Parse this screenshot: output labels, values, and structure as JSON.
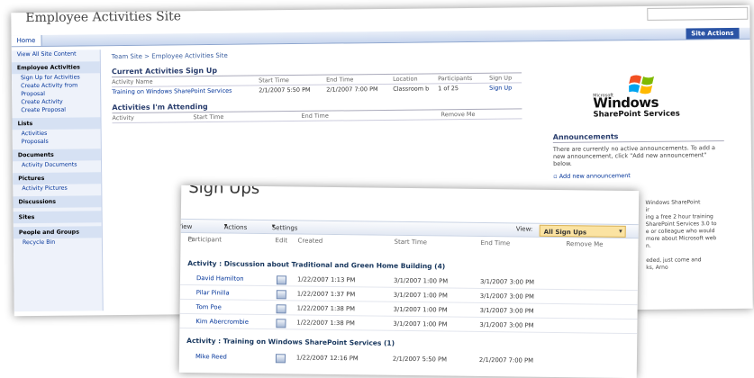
{
  "back": {
    "site_title": "Employee Activities Site",
    "nav_home": "Home",
    "site_actions": "Site Actions",
    "quicklaunch": [
      {
        "text": "View All Site Content",
        "kind": "item"
      },
      {
        "text": "Employee Activities",
        "kind": "head"
      },
      {
        "text": "Sign Up for Activities",
        "kind": "item"
      },
      {
        "text": "Create Activity from Proposal",
        "kind": "item"
      },
      {
        "text": "Create Activity",
        "kind": "item"
      },
      {
        "text": "Create Proposal",
        "kind": "item"
      },
      {
        "text": "Lists",
        "kind": "head"
      },
      {
        "text": "Activities",
        "kind": "item"
      },
      {
        "text": "Proposals",
        "kind": "item"
      },
      {
        "text": "Documents",
        "kind": "head"
      },
      {
        "text": "Activity Documents",
        "kind": "item"
      },
      {
        "text": "Pictures",
        "kind": "head"
      },
      {
        "text": "Activity Pictures",
        "kind": "item"
      },
      {
        "text": "Discussions",
        "kind": "head"
      },
      {
        "text": "Sites",
        "kind": "head"
      },
      {
        "text": "People and Groups",
        "kind": "head"
      },
      {
        "text": "Recycle Bin",
        "kind": "item"
      }
    ],
    "breadcrumb": "Team Site > Employee Activities Site",
    "current": {
      "title": "Current Activities Sign Up",
      "columns": [
        "Activity Name",
        "Start Time",
        "End Time",
        "Location",
        "Participants",
        "Sign Up"
      ],
      "row": [
        "Training on Windows SharePoint Services",
        "2/1/2007 5:50 PM",
        "2/1/2007 7:00 PM",
        "Classroom b",
        "1 of 25",
        "Sign Up"
      ]
    },
    "attending": {
      "title": "Activities I'm Attending",
      "columns": [
        "Activity",
        "Start Time",
        "End Time",
        "Remove Me"
      ]
    },
    "logo": {
      "small": "Microsoft",
      "line1": "Windows",
      "line2": "SharePoint Services"
    },
    "announcements": {
      "title": "Announcements",
      "body": "There are currently no active announcements. To add a new announcement, click \"Add new announcement\" below.",
      "link": "Add new announcement"
    },
    "side2_lines": [
      "Windows SharePoint",
      "ir",
      "ing a free 2 hour training",
      "SharePoint Services 3.0 to",
      "e or colleague who would",
      "more about Microsoft web",
      "n.",
      "",
      "eded, just come and",
      "ks, Arno"
    ]
  },
  "front": {
    "title": "Sign Ups",
    "toolbar": {
      "view": "View",
      "actions": "Actions",
      "settings": "Settings",
      "view_label": "View:",
      "view_value": "All Sign Ups"
    },
    "columns": [
      "Participant",
      "Edit",
      "Created",
      "Start Time",
      "End Time",
      "Remove Me"
    ],
    "group1": "Activity : Discussion about Traditional and Green Home Building (4)",
    "rows": [
      [
        "David Hamilton",
        "1/22/2007 1:13 PM",
        "3/1/2007 1:00 PM",
        "3/1/2007 3:00 PM"
      ],
      [
        "Pilar Pinilla",
        "1/22/2007 1:37 PM",
        "3/1/2007 1:00 PM",
        "3/1/2007 3:00 PM"
      ],
      [
        "Tom Poe",
        "1/22/2007 1:38 PM",
        "3/1/2007 1:00 PM",
        "3/1/2007 3:00 PM"
      ],
      [
        "Kim Abercrombie",
        "1/22/2007 1:38 PM",
        "3/1/2007 1:00 PM",
        "3/1/2007 3:00 PM"
      ]
    ],
    "group2": "Activity : Training on Windows SharePoint Services (1)",
    "row_last": [
      "Mike Reed",
      "1/22/2007 12:16 PM",
      "2/1/2007 5:50 PM",
      "2/1/2007 7:00 PM"
    ]
  },
  "colors": {
    "accent": "#2b54a5",
    "link": "#003399",
    "view_highlight": "#fbe3a2"
  }
}
